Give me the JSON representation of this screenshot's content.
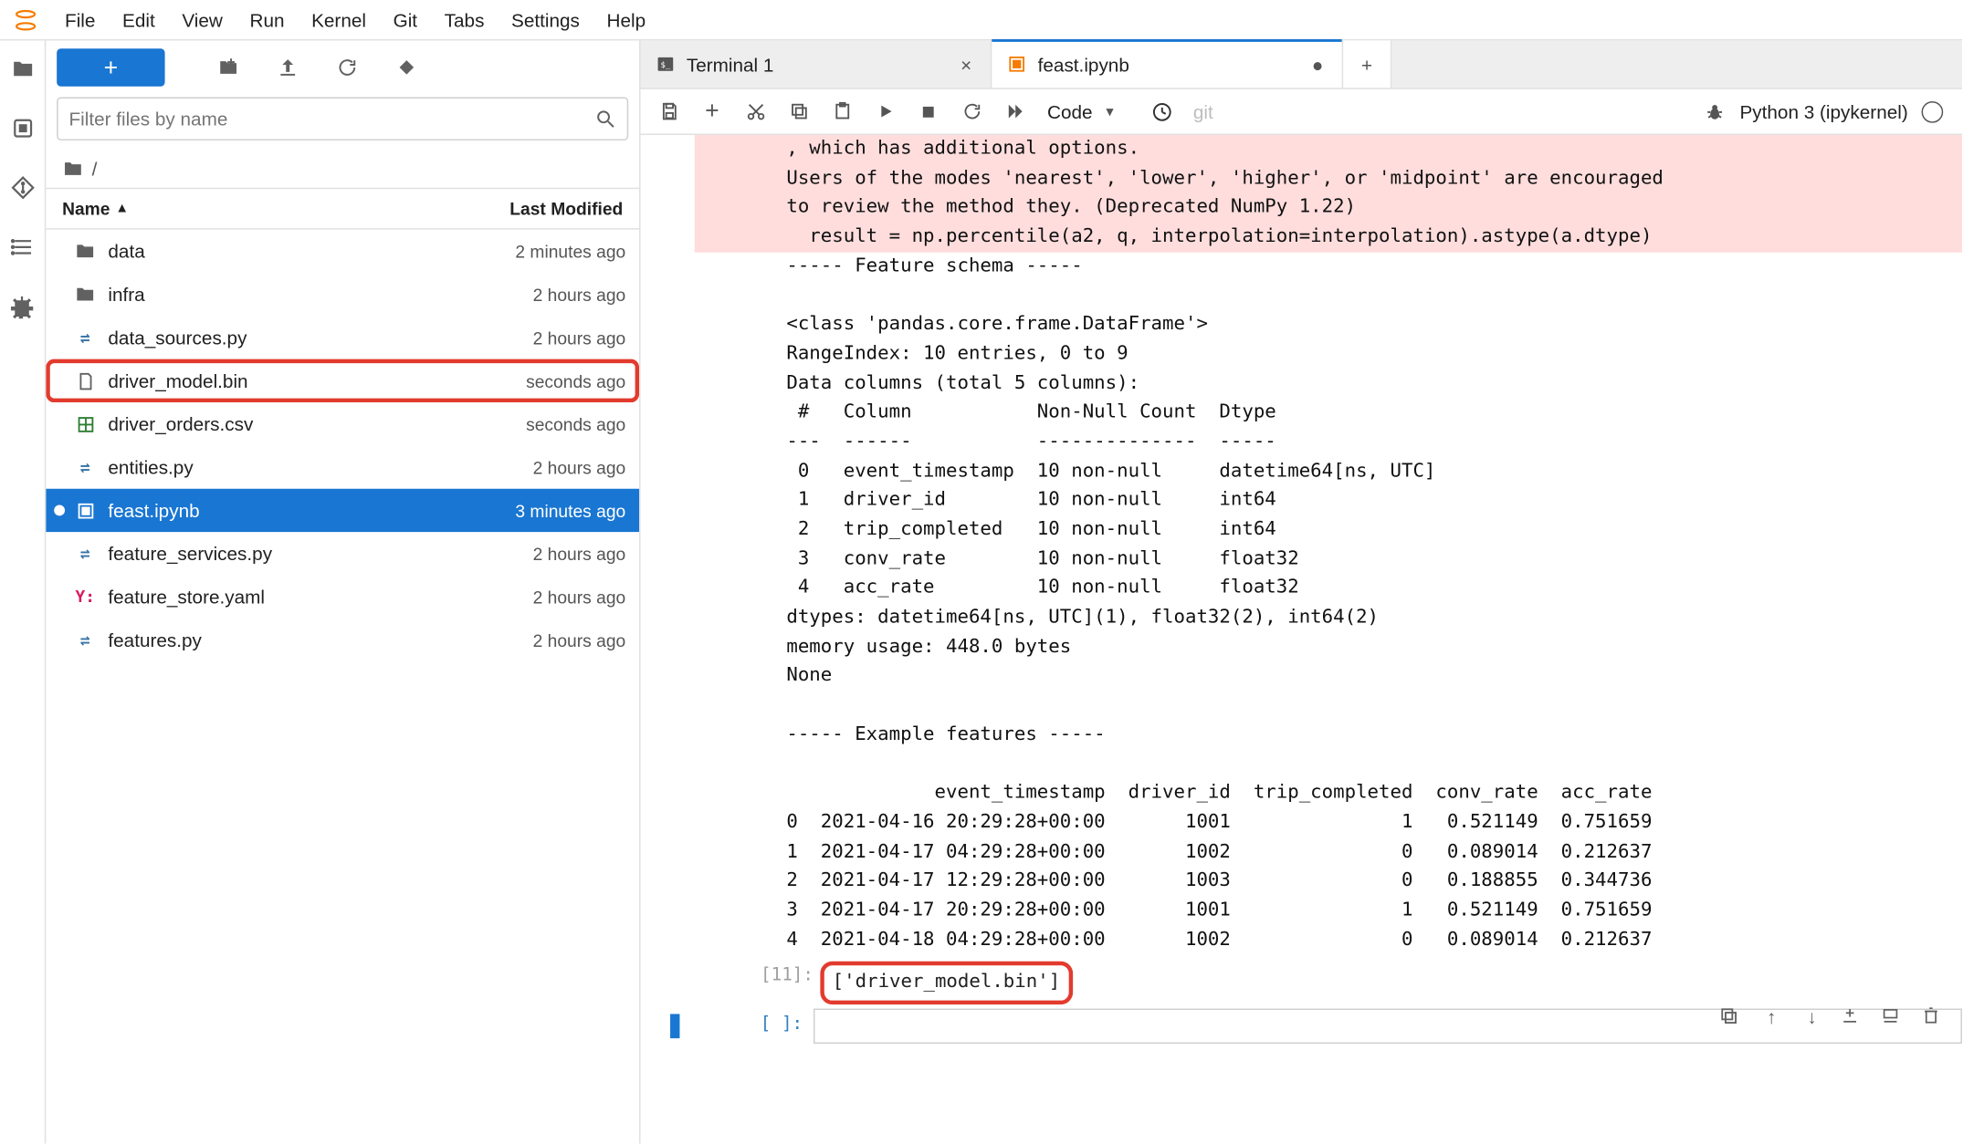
{
  "menubar": [
    "File",
    "Edit",
    "View",
    "Run",
    "Kernel",
    "Git",
    "Tabs",
    "Settings",
    "Help"
  ],
  "filter_placeholder": "Filter files by name",
  "breadcrumb": "/",
  "cols": {
    "name": "Name",
    "mod": "Last Modified"
  },
  "files": [
    {
      "icon": "folder",
      "name": "data",
      "mod": "2 minutes ago"
    },
    {
      "icon": "folder",
      "name": "infra",
      "mod": "2 hours ago"
    },
    {
      "icon": "py",
      "name": "data_sources.py",
      "mod": "2 hours ago"
    },
    {
      "icon": "file",
      "name": "driver_model.bin",
      "mod": "seconds ago",
      "highlight": true
    },
    {
      "icon": "csv",
      "name": "driver_orders.csv",
      "mod": "seconds ago"
    },
    {
      "icon": "py",
      "name": "entities.py",
      "mod": "2 hours ago"
    },
    {
      "icon": "nb",
      "name": "feast.ipynb",
      "mod": "3 minutes ago",
      "selected": true,
      "dirty": true
    },
    {
      "icon": "py",
      "name": "feature_services.py",
      "mod": "2 hours ago"
    },
    {
      "icon": "yaml",
      "name": "feature_store.yaml",
      "mod": "2 hours ago"
    },
    {
      "icon": "py",
      "name": "features.py",
      "mod": "2 hours ago"
    }
  ],
  "tabs": [
    {
      "icon": "term",
      "label": "Terminal 1",
      "active": false,
      "close": "×"
    },
    {
      "icon": "nb",
      "label": "feast.ipynb",
      "active": true,
      "close": "●"
    }
  ],
  "celltype": "Code",
  "git_label": "git",
  "kernel_name": "Python 3 (ipykernel)",
  "warning_text": ", which has additional options.\nUsers of the modes 'nearest', 'lower', 'higher', or 'midpoint' are encouraged\nto review the method they. (Deprecated NumPy 1.22)\n  result = np.percentile(a2, q, interpolation=interpolation).astype(a.dtype)",
  "stdout_text": "----- Feature schema -----\n\n<class 'pandas.core.frame.DataFrame'>\nRangeIndex: 10 entries, 0 to 9\nData columns (total 5 columns):\n #   Column           Non-Null Count  Dtype\n---  ------           --------------  -----\n 0   event_timestamp  10 non-null     datetime64[ns, UTC]\n 1   driver_id        10 non-null     int64\n 2   trip_completed   10 non-null     int64\n 3   conv_rate        10 non-null     float32\n 4   acc_rate         10 non-null     float32\ndtypes: datetime64[ns, UTC](1), float32(2), int64(2)\nmemory usage: 448.0 bytes\nNone\n\n----- Example features -----\n\n             event_timestamp  driver_id  trip_completed  conv_rate  acc_rate\n0  2021-04-16 20:29:28+00:00       1001               1   0.521149  0.751659\n1  2021-04-17 04:29:28+00:00       1002               0   0.089014  0.212637\n2  2021-04-17 12:29:28+00:00       1003               0   0.188855  0.344736\n3  2021-04-17 20:29:28+00:00       1001               1   0.521149  0.751659\n4  2021-04-18 04:29:28+00:00       1002               0   0.089014  0.212637",
  "out_prompt": "[11]:",
  "out_value": "['driver_model.bin']",
  "empty_prompt": "[ ]:"
}
